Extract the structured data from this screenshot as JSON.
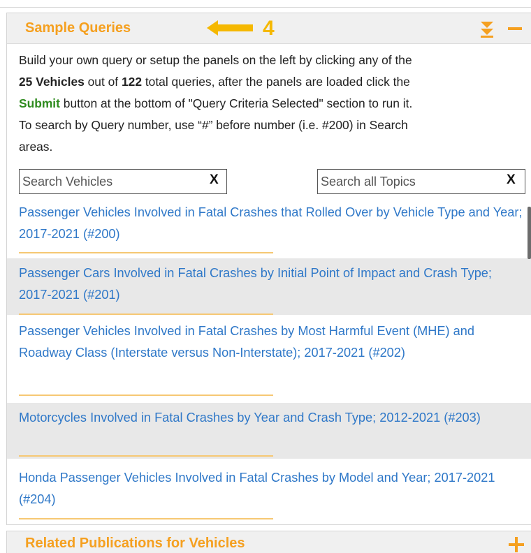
{
  "sample_queries": {
    "title": "Sample Queries",
    "callout_number": "4",
    "intro": {
      "line1": "Build your own query or setup the panels on the left by clicking any of the",
      "count_vehicles": "25 Vehicles",
      "mid1": " out of ",
      "count_total": "122",
      "mid2": " total queries, after the panels are loaded click the",
      "submit_word": "Submit",
      "line3": " button at the bottom of \"Query Criteria Selected\" section to run it.",
      "line4": "To search by Query number, use “#” before number (i.e. #200) in Search",
      "line5": "areas."
    },
    "search_vehicles": {
      "placeholder": "Search Vehicles",
      "clear": "X"
    },
    "search_topics": {
      "placeholder": "Search all Topics",
      "clear": "X"
    },
    "queries": [
      {
        "text": "Passenger Vehicles Involved in Fatal Crashes that Rolled Over by Vehicle Type and Year; 2017-2021 (#200)"
      },
      {
        "text": "Passenger Cars Involved in Fatal Crashes by Initial Point of Impact and Crash Type; 2017-2021 (#201)"
      },
      {
        "text": "Passenger Vehicles Involved in Fatal Crashes by Most Harmful Event (MHE) and Roadway Class (Interstate versus Non-Interstate); 2017-2021 (#202)"
      },
      {
        "text": "Motorcycles Involved in Fatal Crashes by Year and Crash Type; 2012-2021 (#203)"
      },
      {
        "text": "Honda Passenger Vehicles Involved in Fatal Crashes by Model and Year; 2017-2021 (#204)"
      }
    ]
  },
  "related_publications": {
    "title": "Related Publications for Vehicles"
  },
  "colors": {
    "accent_orange": "#f5a020",
    "callout_yellow": "#f5b800",
    "link_blue": "#2f78c8",
    "submit_green": "#2e8b1e"
  },
  "icons": {
    "callout": "arrow-left-icon",
    "collapse": "double-chevron-down-icon",
    "minimize": "minus-icon",
    "expand": "plus-icon"
  }
}
